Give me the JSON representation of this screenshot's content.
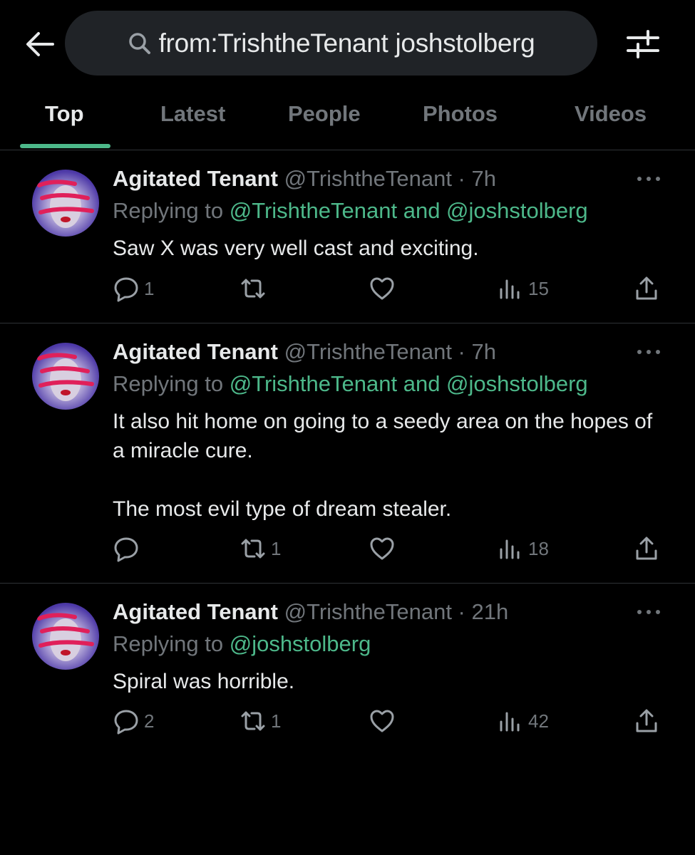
{
  "search": {
    "query": "from:TrishtheTenant joshstolberg"
  },
  "tabs": [
    "Top",
    "Latest",
    "People",
    "Photos",
    "Videos"
  ],
  "colors": {
    "accent": "#4db88a",
    "muted": "#71767b",
    "text": "#e7e9ea",
    "background": "#000000"
  },
  "icons": [
    "back-arrow-icon",
    "search-icon",
    "filter-sliders-icon",
    "more-icon",
    "reply-icon",
    "repost-icon",
    "like-icon",
    "views-icon",
    "share-icon"
  ],
  "tweets": [
    {
      "name": "Agitated Tenant",
      "meta": "@TrishtheTenant · 7h",
      "reply_prefix": "Replying to ",
      "reply_mentions": "@TrishtheTenant and @joshstolberg",
      "text": "Saw X was very well cast and exciting.",
      "replies": "1",
      "reposts": "",
      "likes": "",
      "views": "15"
    },
    {
      "name": "Agitated Tenant",
      "meta": "@TrishtheTenant · 7h",
      "reply_prefix": "Replying to ",
      "reply_mentions": "@TrishtheTenant and @joshstolberg",
      "text": "It also hit home on going to a seedy area on the hopes of  a miracle cure.\n\nThe most evil type of dream stealer.",
      "replies": "",
      "reposts": "1",
      "likes": "",
      "views": "18"
    },
    {
      "name": "Agitated Tenant",
      "meta": "@TrishtheTenant · 21h",
      "reply_prefix": "Replying to ",
      "reply_mentions": "@joshstolberg",
      "text": "Spiral was horrible.",
      "replies": "2",
      "reposts": "1",
      "likes": "",
      "views": "42"
    }
  ]
}
